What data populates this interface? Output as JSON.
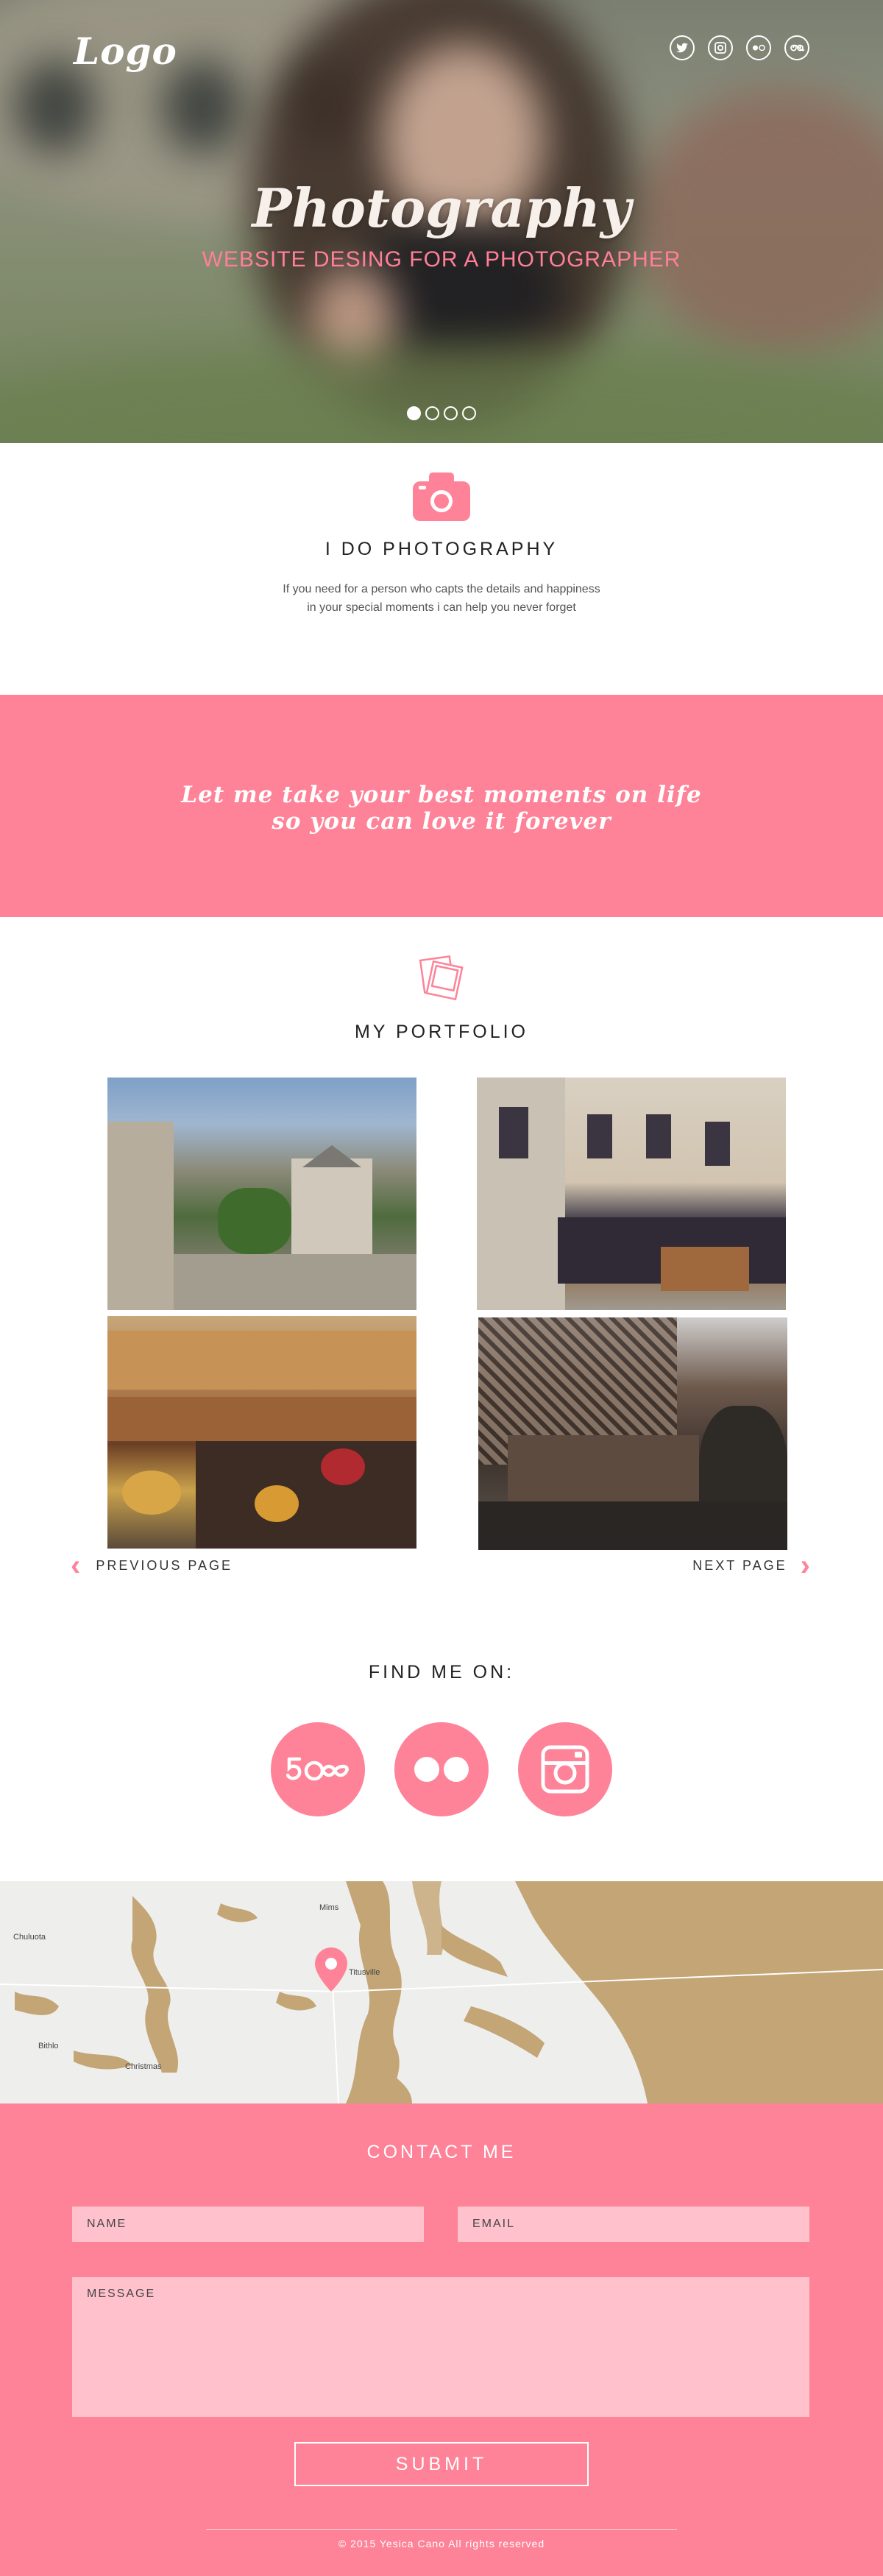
{
  "header": {
    "logo": "Logo",
    "social_icons": [
      "twitter-icon",
      "instagram-icon",
      "flickr-icon",
      "500px-icon"
    ]
  },
  "hero": {
    "title": "Photography",
    "subtitle": "WEBSITE DESING FOR A PHOTOGRAPHER",
    "slides": 4,
    "active_slide": 1
  },
  "intro": {
    "icon": "camera-icon",
    "heading": "I DO PHOTOGRAPHY",
    "text_line1": "If you need for a person who capts the details and happiness",
    "text_line2": "in your special moments i can help you never forget"
  },
  "quote": {
    "line1": "Let me take your best moments on life",
    "line2": "so you can love it forever"
  },
  "portfolio": {
    "icon": "polaroid-icon",
    "heading": "MY PORTFOLIO",
    "prev_label": "PREVIOUS PAGE",
    "next_label": "NEXT PAGE"
  },
  "findme": {
    "heading": "FIND ME ON:",
    "items": [
      {
        "name": "500px",
        "icon": "500px-icon"
      },
      {
        "name": "flickr",
        "icon": "flickr-icon"
      },
      {
        "name": "instagram",
        "icon": "instagram-icon"
      }
    ]
  },
  "map": {
    "labels": {
      "mims": "Mims",
      "titusville": "Titusville",
      "chuluota": "Chuluota",
      "bithlo": "Bithlo",
      "christmas": "Christmas"
    }
  },
  "contact": {
    "heading": "CONTACT ME",
    "name_placeholder": "NAME",
    "email_placeholder": "EMAIL",
    "message_placeholder": "MESSAGE",
    "submit_label": "SUBMIT",
    "copyright": "© 2015 Yesica Cano All rights reserved"
  },
  "colors": {
    "accent": "#fe8398",
    "field_bg": "#ffc2cd",
    "map_land": "#c4a575",
    "map_bg": "#eeeeec"
  }
}
